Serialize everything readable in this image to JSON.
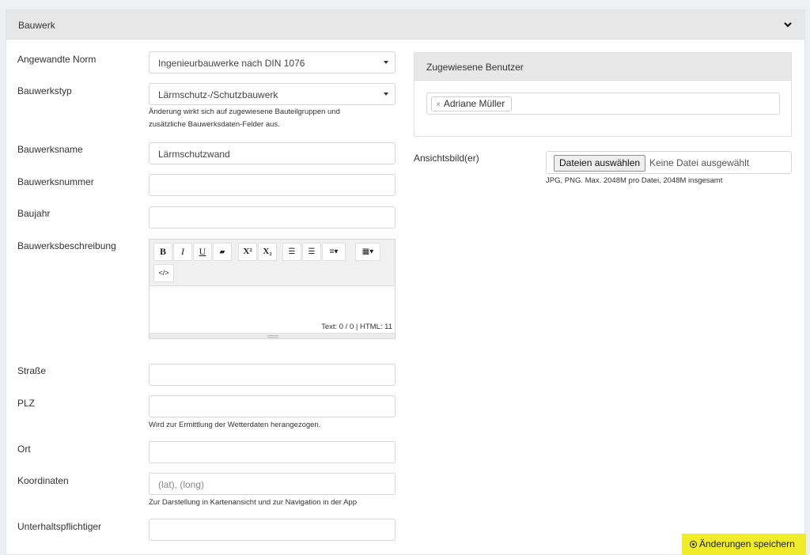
{
  "section": {
    "title": "Bauwerk"
  },
  "form": {
    "norm": {
      "label": "Angewandte Norm",
      "value": "Ingenieurbauwerke nach DIN 1076"
    },
    "type": {
      "label": "Bauwerkstyp",
      "value": "Lärmschutz-/Schutzbauwerk",
      "help_line1": "Änderung wirkt sich auf zugewiesene Bauteilgruppen und",
      "help_line2": "zusätzliche Bauwerksdaten-Felder aus."
    },
    "name": {
      "label": "Bauwerksname",
      "value": "Lärmschutzwand"
    },
    "number": {
      "label": "Bauwerksnummer",
      "value": ""
    },
    "year": {
      "label": "Baujahr",
      "value": ""
    },
    "description": {
      "label": "Bauwerksbeschreibung",
      "status": "Text: 0 / 0 | HTML: 11"
    },
    "street": {
      "label": "Straße",
      "value": ""
    },
    "zip": {
      "label": "PLZ",
      "value": "",
      "help": "Wird zur Ermittlung der Wetterdaten herangezogen."
    },
    "city": {
      "label": "Ort",
      "value": ""
    },
    "coords": {
      "label": "Koordinaten",
      "placeholder": "(lat), (long)",
      "help": "Zur Darstellung in Kartenansicht und zur Navigation in der App"
    },
    "maintainer": {
      "label": "Unterhaltspflichtiger",
      "value": ""
    }
  },
  "toolbar": {
    "bold": "B",
    "italic": "I",
    "underline": "U",
    "clear": "▰",
    "superscript": "X²",
    "subscript": "X₂",
    "ul": "☰",
    "ol": "☰",
    "align": "≡▾",
    "table": "▦▾",
    "code": "</>"
  },
  "assigned_users": {
    "title": "Zugewiesene Benutzer",
    "users": [
      "Adriane Müller"
    ],
    "remove": "×"
  },
  "images": {
    "label": "Ansichtsbild(er)",
    "button": "Dateien auswählen",
    "no_file": "Keine Datei ausgewählt",
    "help": "JPG, PNG. Max. 2048M pro Datei, 2048M insgesamt"
  },
  "save": {
    "label": "Änderungen speichern"
  },
  "colors": {
    "accent": "#f0ec2c",
    "header_bg": "#e7e7e8"
  }
}
